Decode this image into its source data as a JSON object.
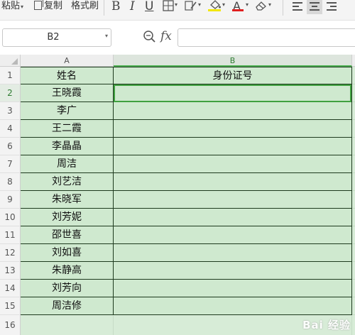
{
  "toolbar": {
    "paste_label": "粘贴",
    "copy_label": "复制",
    "format_painter_label": "格式刷",
    "bold_glyph": "B",
    "italic_glyph": "I",
    "underline_glyph": "U",
    "font_color_glyph": "A",
    "icons": [
      "paste-icon",
      "copy-icon",
      "format-painter-icon",
      "bold-icon",
      "italic-icon",
      "underline-icon",
      "border-icon",
      "fill-color-icon",
      "font-color-icon",
      "clear-icon",
      "align-left-icon",
      "align-center-icon",
      "align-right-icon"
    ]
  },
  "formula_bar": {
    "cell_reference": "B2",
    "fx_label": "fx",
    "formula_value": ""
  },
  "sheet": {
    "columns": [
      "A",
      "B"
    ],
    "rows": [
      {
        "num": "1",
        "a": "姓名",
        "b": "身份证号"
      },
      {
        "num": "2",
        "a": "王晓霞",
        "b": ""
      },
      {
        "num": "3",
        "a": "李广",
        "b": ""
      },
      {
        "num": "4",
        "a": "王二霞",
        "b": ""
      },
      {
        "num": "6",
        "a": "李晶晶",
        "b": ""
      },
      {
        "num": "7",
        "a": "周洁",
        "b": ""
      },
      {
        "num": "8",
        "a": "刘艺洁",
        "b": ""
      },
      {
        "num": "9",
        "a": "朱晓军",
        "b": ""
      },
      {
        "num": "10",
        "a": "刘芳妮",
        "b": ""
      },
      {
        "num": "11",
        "a": "邵世喜",
        "b": ""
      },
      {
        "num": "12",
        "a": "刘如喜",
        "b": ""
      },
      {
        "num": "13",
        "a": "朱静高",
        "b": ""
      },
      {
        "num": "14",
        "a": "刘芳向",
        "b": ""
      },
      {
        "num": "15",
        "a": "周洁修",
        "b": ""
      },
      {
        "num": "16",
        "a": "",
        "b": ""
      }
    ],
    "selected_cell": "B2",
    "selection_color": "#3fa03f",
    "cell_fill_color": "#cfe9cf"
  },
  "watermark": "Bai 经验"
}
